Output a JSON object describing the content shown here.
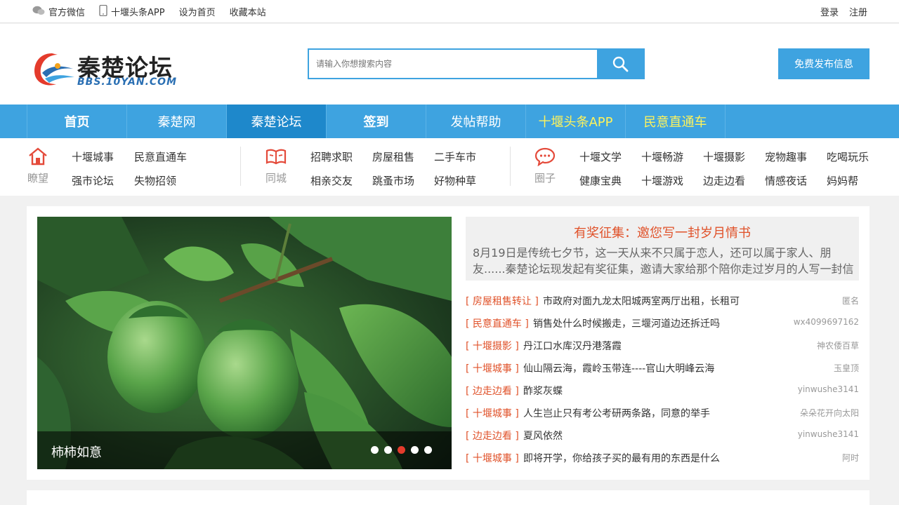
{
  "topbar": {
    "left": [
      "官方微信",
      "十堰头条APP",
      "设为首页",
      "收藏本站"
    ],
    "login": "登录",
    "register": "注册"
  },
  "header": {
    "logo_cn": "秦楚论坛",
    "logo_en": "BBS.10YAN.COM",
    "search_placeholder": "请输入你想搜索内容",
    "publish": "免费发布信息"
  },
  "nav": [
    "首页",
    "秦楚网",
    "秦楚论坛",
    "签到",
    "发帖帮助",
    "十堰头条APP",
    "民意直通车"
  ],
  "subnav": {
    "g1": {
      "label": "瞭望",
      "links": [
        "十堰城事",
        "民意直通车",
        "强市论坛",
        "失物招领"
      ]
    },
    "g2": {
      "label": "同城",
      "links": [
        "招聘求职",
        "房屋租售",
        "二手车市",
        "相亲交友",
        "跳蚤市场",
        "好物种草"
      ]
    },
    "g3": {
      "label": "圈子",
      "links": [
        "十堰文学",
        "十堰畅游",
        "十堰摄影",
        "宠物趣事",
        "吃喝玩乐",
        "健康宝典",
        "十堰游戏",
        "边走边看",
        "情感夜话",
        "妈妈帮"
      ]
    }
  },
  "slide": {
    "caption": "柿柿如意",
    "dots": 5,
    "active_dot": 3
  },
  "feature": {
    "title": "有奖征集：邀您写一封岁月情书",
    "desc": "8月19日是传统七夕节，这一天从来不只属于恋人，还可以属于家人、朋友......秦楚论坛现发起有奖征集，邀请大家给那个陪你走过岁月的人写一封信"
  },
  "news": [
    {
      "tag": "[ 房屋租售转让 ]",
      "title": "市政府对面九龙太阳城两室两厅出租，长租可",
      "author": "匿名"
    },
    {
      "tag": "[ 民意直通车 ]",
      "title": "销售处什么时候搬走，三堰河道边还拆迁吗",
      "author": "wx4099697162"
    },
    {
      "tag": "[ 十堰摄影 ]",
      "title": "丹江口水库汉丹港落霞",
      "author": "神农倭百草"
    },
    {
      "tag": "[ 十堰城事 ]",
      "title": "仙山隔云海，霞岭玉带连----官山大明峰云海",
      "author": "玉皇顶"
    },
    {
      "tag": "[ 边走边看 ]",
      "title": "酢浆灰蝶",
      "author": "yinwushe3141"
    },
    {
      "tag": "[ 十堰城事 ]",
      "title": "人生岂止只有考公考研两条路，同意的举手",
      "author": "朵朵花开向太阳"
    },
    {
      "tag": "[ 边走边看 ]",
      "title": "夏风依然",
      "author": "yinwushe3141"
    },
    {
      "tag": "[ 十堰城事 ]",
      "title": "即将开学，你给孩子买的最有用的东西是什么",
      "author": "阿时"
    }
  ],
  "colors": {
    "primary": "#3ea3e0",
    "accent": "#e0522a",
    "nav_yellow": "#fff35b"
  }
}
